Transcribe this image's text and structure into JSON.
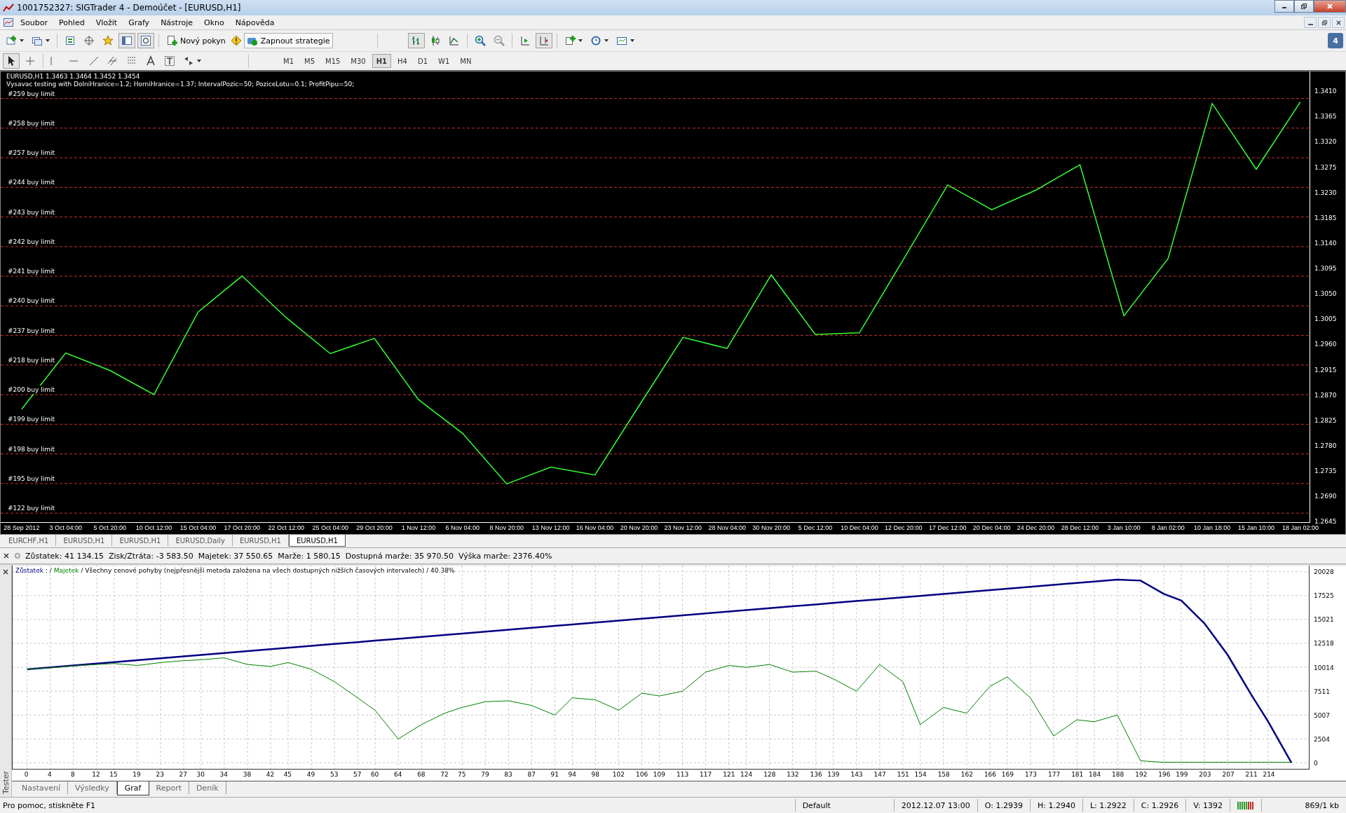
{
  "window": {
    "title": "1001752327: SIGTrader 4 - Demoúčet - [EURUSD,H1]"
  },
  "menu": [
    "Soubor",
    "Pohled",
    "Vložit",
    "Grafy",
    "Nástroje",
    "Okno",
    "Nápověda"
  ],
  "toolbar": {
    "new_order": "Nový pokyn",
    "strategy": "Zapnout strategie",
    "notifications": "4"
  },
  "timeframes": [
    {
      "label": "M1",
      "selected": false
    },
    {
      "label": "M5",
      "selected": false
    },
    {
      "label": "M15",
      "selected": false
    },
    {
      "label": "M30",
      "selected": false
    },
    {
      "label": "H1",
      "selected": true
    },
    {
      "label": "H4",
      "selected": false
    },
    {
      "label": "D1",
      "selected": false
    },
    {
      "label": "W1",
      "selected": false
    },
    {
      "label": "MN",
      "selected": false
    }
  ],
  "chart": {
    "header": "EURUSD,H1  1.3463 1.3464 1.3452 1.3454",
    "comment": "Vysavac testing with DolniHranice=1.2; HorniHranice=1.37; IntervalPozic=50; PoziceLotu=0.1; ProfitPipu=50;",
    "orders": [
      "#259 buy limit",
      "#258 buy limit",
      "#257 buy limit",
      "#244 buy limit",
      "#243 buy limit",
      "#242 buy limit",
      "#241 buy limit",
      "#240 buy limit",
      "#237 buy limit",
      "#218 buy limit",
      "#200 buy limit",
      "#199 buy limit",
      "#198 buy limit",
      "#195 buy limit",
      "#122 buy limit"
    ],
    "chart_data": {
      "type": "line",
      "categories": [
        "28 Sep 2012",
        "3 Oct 04:00",
        "5 Oct 20:00",
        "10 Oct 12:00",
        "15 Oct 04:00",
        "17 Oct 20:00",
        "22 Oct 12:00",
        "25 Oct 04:00",
        "29 Oct 20:00",
        "1 Nov 12:00",
        "6 Nov 04:00",
        "8 Nov 20:00",
        "13 Nov 12:00",
        "16 Nov 04:00",
        "20 Nov 20:00",
        "23 Nov 12:00",
        "28 Nov 04:00",
        "30 Nov 20:00",
        "5 Dec 12:00",
        "10 Dec 04:00",
        "12 Dec 20:00",
        "17 Dec 12:00",
        "20 Dec 04:00",
        "24 Dec 20:00",
        "28 Dec 12:00",
        "3 Jan 10:00",
        "8 Jan 02:00",
        "10 Jan 18:00",
        "15 Jan 10:00",
        "18 Jan 02:00"
      ],
      "series": [
        {
          "color": "#33ff33",
          "values": [
            1.2844,
            1.2944,
            1.2913,
            1.287,
            1.3017,
            1.3081,
            1.3007,
            1.2943,
            1.297,
            1.2861,
            1.2801,
            1.2711,
            1.2741,
            1.2727,
            1.285,
            1.2972,
            1.2952,
            1.3083,
            1.2977,
            1.298,
            1.3111,
            1.3243,
            1.3199,
            1.3234,
            1.3279,
            1.301,
            1.3112,
            1.3388,
            1.3271,
            1.3391
          ]
        }
      ],
      "ylim": [
        1.2643,
        1.3445
      ],
      "yticks": [
        {
          "value": 1.341,
          "label": "1.3410"
        },
        {
          "value": 1.3365,
          "label": "1.3365"
        },
        {
          "value": 1.332,
          "label": "1.3320"
        },
        {
          "value": 1.3275,
          "label": "1.3275"
        },
        {
          "value": 1.323,
          "label": "1.3230"
        },
        {
          "value": 1.3185,
          "label": "1.3185"
        },
        {
          "value": 1.314,
          "label": "1.3140"
        },
        {
          "value": 1.3095,
          "label": "1.3095"
        },
        {
          "value": 1.305,
          "label": "1.3050"
        },
        {
          "value": 1.3005,
          "label": "1.3005"
        },
        {
          "value": 1.296,
          "label": "1.2960"
        },
        {
          "value": 1.2915,
          "label": "1.2915"
        },
        {
          "value": 1.287,
          "label": "1.2870"
        },
        {
          "value": 1.2825,
          "label": "1.2825"
        },
        {
          "value": 1.278,
          "label": "1.2780"
        },
        {
          "value": 1.2735,
          "label": "1.2735"
        },
        {
          "value": 1.269,
          "label": "1.2690"
        },
        {
          "value": 1.2645,
          "label": "1.2645"
        }
      ]
    }
  },
  "chart_tabs": [
    {
      "label": "EURCHF,H1",
      "selected": false
    },
    {
      "label": "EURUSD,H1",
      "selected": false
    },
    {
      "label": "EURUSD,H1",
      "selected": false
    },
    {
      "label": "EURUSD,Daily",
      "selected": false
    },
    {
      "label": "EURUSD,H1",
      "selected": false
    },
    {
      "label": "EURUSD,H1",
      "selected": true
    }
  ],
  "account": "Zůstatek: 41 134.15  Zisk/Ztráta: -3 583.50  Majetek: 37 550.65  Marže: 1 580.15  Dostupná marže: 35 970.50  Výška marže: 2376.40%",
  "tester": {
    "title": "Tester",
    "legend_separators": [
      ": /",
      "/ Všechny cenové pohyby (nejpřesnější metoda založena na všech dostupných nižších časových intervalech) / 40.38%"
    ],
    "chart_data": {
      "type": "line",
      "x": [
        0,
        4,
        8,
        12,
        15,
        19,
        23,
        27,
        30,
        34,
        38,
        42,
        45,
        49,
        53,
        57,
        60,
        64,
        68,
        72,
        75,
        79,
        83,
        87,
        91,
        94,
        98,
        102,
        106,
        109,
        113,
        117,
        121,
        124,
        128,
        132,
        136,
        139,
        143,
        147,
        151,
        154,
        158,
        162,
        166,
        169,
        173,
        177,
        181,
        184,
        188,
        192,
        196,
        199,
        203,
        207,
        211,
        214,
        218
      ],
      "series": [
        {
          "name": "Zůstatek",
          "color": "#000080",
          "values": [
            9800,
            10000,
            10200,
            10400,
            10550,
            10750,
            10950,
            11150,
            11300,
            11500,
            11700,
            11900,
            12050,
            12250,
            12450,
            12650,
            12800,
            13000,
            13200,
            13400,
            13550,
            13750,
            13950,
            14150,
            14350,
            14500,
            14700,
            14900,
            15100,
            15250,
            15450,
            15650,
            15850,
            16000,
            16200,
            16400,
            16600,
            16750,
            16950,
            17150,
            17350,
            17500,
            17700,
            17900,
            18100,
            18250,
            18450,
            18650,
            18850,
            19000,
            19200,
            19100,
            17700,
            17000,
            14600,
            11300,
            7200,
            4300,
            0
          ]
        },
        {
          "name": "Majetek",
          "color": "#008000",
          "values": [
            9800,
            9950,
            10150,
            10300,
            10400,
            10200,
            10500,
            10700,
            10800,
            11000,
            10300,
            10100,
            10500,
            9800,
            8500,
            6800,
            5500,
            2500,
            4000,
            5200,
            5800,
            6400,
            6500,
            6000,
            5000,
            6800,
            6600,
            5500,
            7300,
            7000,
            7500,
            9500,
            10200,
            10000,
            10300,
            9500,
            9600,
            8800,
            7500,
            10300,
            8500,
            4000,
            5800,
            5200,
            8000,
            9000,
            6800,
            2800,
            4500,
            4300,
            5000,
            200,
            50,
            50,
            50,
            50,
            50,
            50,
            50
          ]
        }
      ],
      "xlim": [
        -2.5,
        221
      ],
      "ylim": [
        -640,
        20670
      ],
      "grid": true,
      "xticks": [
        0,
        4,
        8,
        12,
        15,
        19,
        23,
        27,
        30,
        34,
        38,
        42,
        45,
        49,
        53,
        57,
        60,
        64,
        68,
        72,
        75,
        79,
        83,
        87,
        91,
        94,
        98,
        102,
        106,
        109,
        113,
        117,
        121,
        124,
        128,
        132,
        136,
        139,
        143,
        147,
        151,
        154,
        158,
        162,
        166,
        169,
        173,
        177,
        181,
        184,
        188,
        192,
        196,
        199,
        203,
        207,
        211,
        214
      ],
      "yticks": [
        0,
        2504,
        5007,
        7511,
        10014,
        12518,
        15021,
        17525,
        20028
      ]
    },
    "tabs": [
      {
        "label": "Nastavení",
        "selected": false
      },
      {
        "label": "Výsledky",
        "selected": false
      },
      {
        "label": "Graf",
        "selected": true
      },
      {
        "label": "Report",
        "selected": false
      },
      {
        "label": "Deník",
        "selected": false
      }
    ]
  },
  "status_bar": {
    "help": "Pro pomoc, stiskněte F1",
    "profile": "Default",
    "time": "2012.12.07 13:00",
    "open": "O: 1.2939",
    "high": "H: 1.2940",
    "low": "L: 1.2922",
    "close": "C: 1.2926",
    "volume": "V: 1392",
    "traffic": "869/1 kb"
  }
}
